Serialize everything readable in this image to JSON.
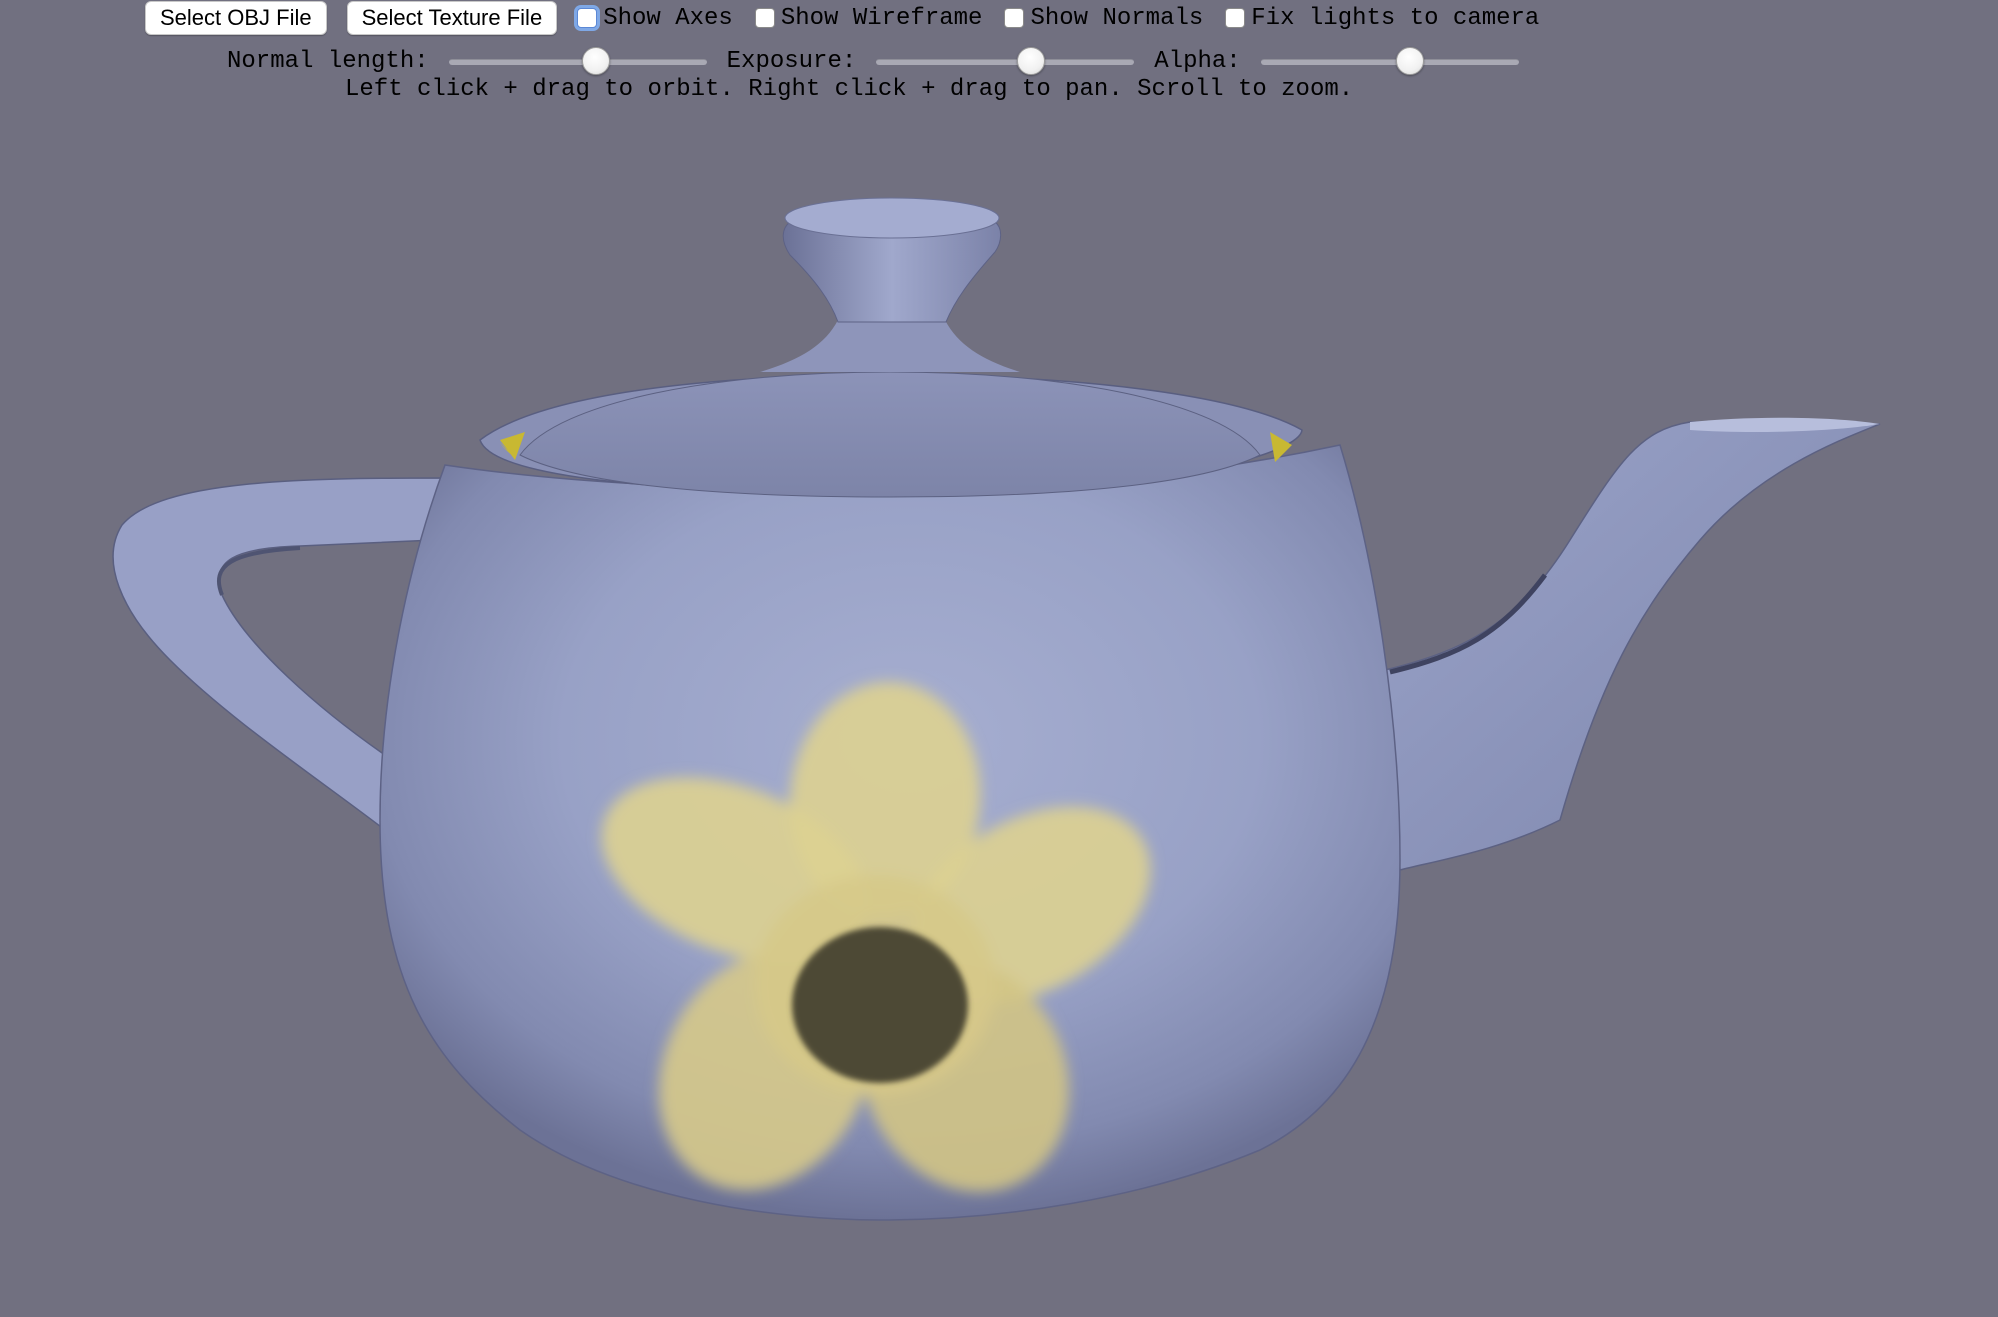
{
  "toolbar": {
    "buttons": {
      "select_obj": "Select OBJ File",
      "select_texture": "Select Texture File"
    },
    "checkboxes": [
      {
        "label": "Show Axes",
        "checked": false,
        "focused": true
      },
      {
        "label": "Show Wireframe",
        "checked": false,
        "focused": false
      },
      {
        "label": "Show Normals",
        "checked": false,
        "focused": false
      },
      {
        "label": "Fix lights to camera",
        "checked": false,
        "focused": false
      }
    ],
    "sliders": [
      {
        "label": "Normal length:",
        "value": 0.57
      },
      {
        "label": "Exposure:",
        "value": 0.6
      },
      {
        "label": "Alpha:",
        "value": 0.58
      }
    ],
    "hint": "Left click + drag to orbit. Right click + drag to pan. Scroll to zoom."
  },
  "scene": {
    "background": "#717080",
    "model": "teapot",
    "model_color": "#9aa4c8",
    "texture": "yellow-flower",
    "flower_color": "#d9cf8f",
    "flower_center_color": "#4e4a35"
  }
}
